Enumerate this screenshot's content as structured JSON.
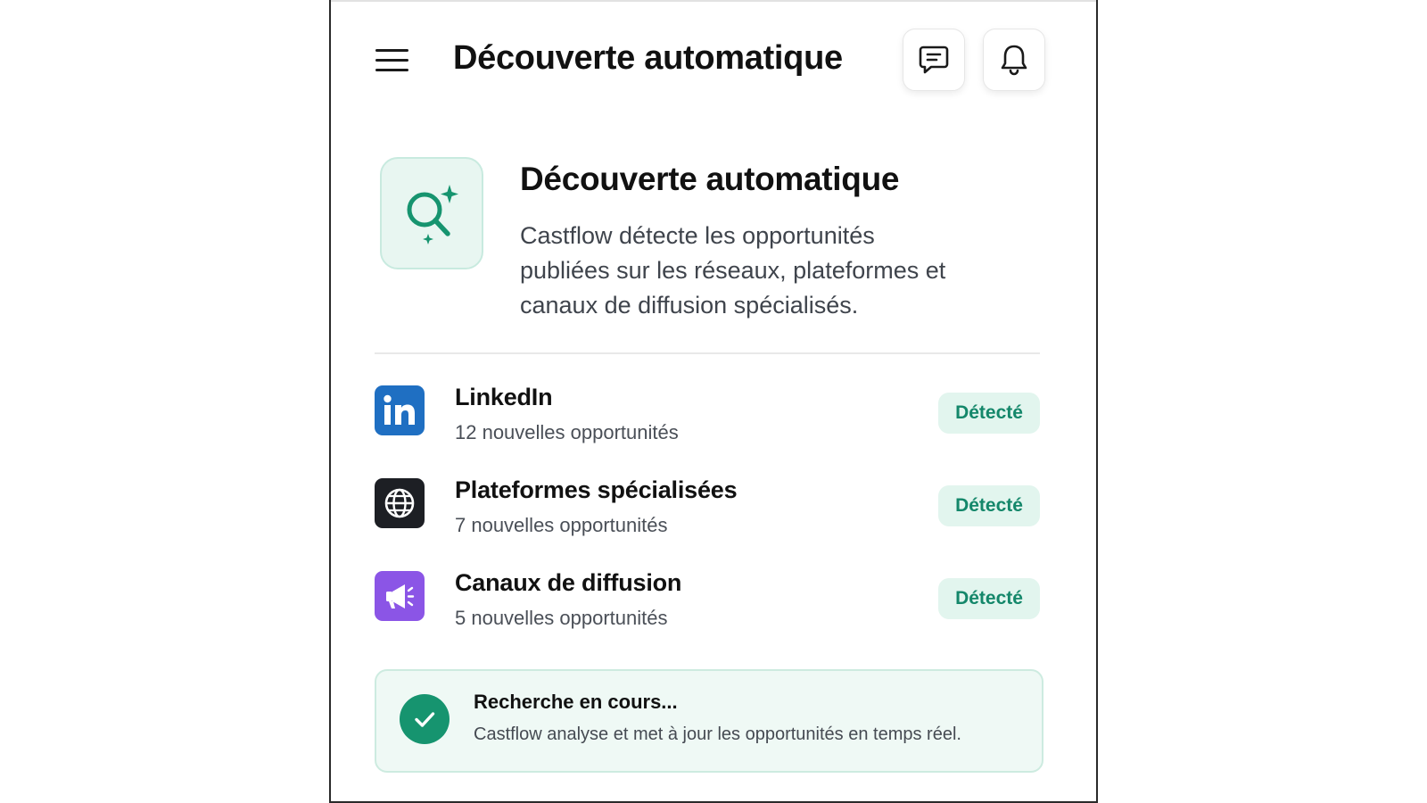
{
  "header": {
    "title": "Découverte automatique",
    "menu_icon": "hamburger-menu-icon",
    "messages_icon": "chat-message-icon",
    "notifications_icon": "bell-icon"
  },
  "hero": {
    "icon": "sparkle-search-icon",
    "title": "Découverte automatique",
    "description": "Castflow détecte les opportunités publiées sur les réseaux, plateformes et canaux de diffusion spécialisés."
  },
  "sources": [
    {
      "name": "LinkedIn",
      "subtitle": "12 nouvelles opportunités",
      "status": "Détecté",
      "icon": "linkedin-icon",
      "icon_color": "#1f6fc2"
    },
    {
      "name": "Plateformes spécialisées",
      "subtitle": "7 nouvelles opportunités",
      "status": "Détecté",
      "icon": "globe-icon",
      "icon_color": "#1d1f24"
    },
    {
      "name": "Canaux de diffusion",
      "subtitle": "5 nouvelles opportunités",
      "status": "Détecté",
      "icon": "megaphone-icon",
      "icon_color": "#8b55e6"
    }
  ],
  "status": {
    "title": "Recherche en cours...",
    "description": "Castflow analyse et met à jour les opportunités en temps réel.",
    "icon": "check-circle-icon"
  },
  "colors": {
    "accent": "#16946f",
    "badge_bg": "#e2f5ee",
    "badge_text": "#14876a"
  }
}
